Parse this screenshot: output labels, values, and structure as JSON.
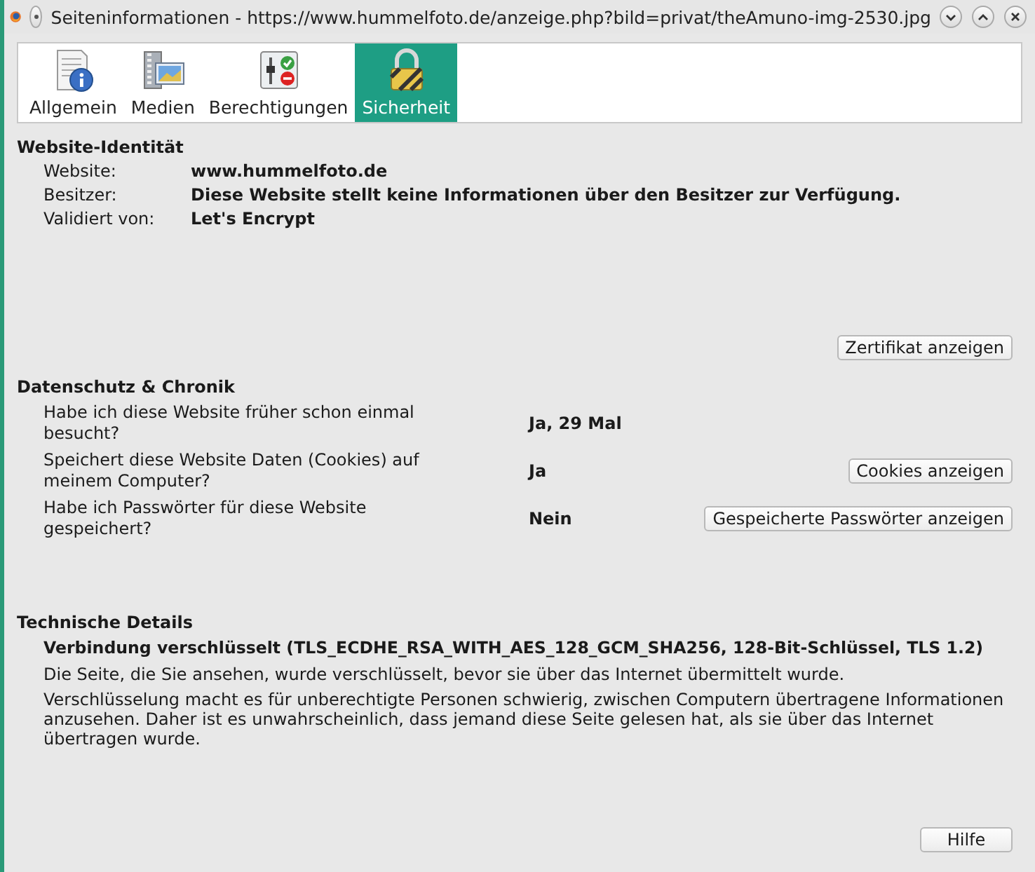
{
  "window": {
    "title": "Seiteninformationen - https://www.hummelfoto.de/anzeige.php?bild=privat/theAmuno-img-2530.jpg"
  },
  "tabs": [
    {
      "label": "Allgemein",
      "kind": "info",
      "selected": false
    },
    {
      "label": "Medien",
      "kind": "media",
      "selected": false
    },
    {
      "label": "Berechtigungen",
      "kind": "permissions",
      "selected": false
    },
    {
      "label": "Sicherheit",
      "kind": "lock",
      "selected": true
    }
  ],
  "identity": {
    "heading": "Website-Identität",
    "rows": [
      {
        "label": "Website:",
        "value": "www.hummelfoto.de"
      },
      {
        "label": "Besitzer:",
        "value": "Diese Website stellt keine Informationen über den Besitzer zur Verfügung."
      },
      {
        "label": "Validiert von:",
        "value": "Let's Encrypt"
      }
    ],
    "button": "Zertifikat anzeigen"
  },
  "privacy": {
    "heading": "Datenschutz & Chronik",
    "rows": [
      {
        "question": "Habe ich diese Website früher schon einmal besucht?",
        "answer": "Ja, 29 Mal"
      },
      {
        "question": "Speichert diese Website Daten (Cookies) auf meinem Computer?",
        "answer": "Ja",
        "button": "Cookies anzeigen"
      },
      {
        "question": "Habe ich Passwörter für diese Website gespeichert?",
        "answer": "Nein",
        "button": "Gespeicherte Passwörter anzeigen"
      }
    ]
  },
  "technical": {
    "heading": "Technische Details",
    "summary": "Verbindung verschlüsselt (TLS_ECDHE_RSA_WITH_AES_128_GCM_SHA256, 128-Bit-Schlüssel, TLS 1.2)",
    "paragraphs": [
      "Die Seite, die Sie ansehen, wurde verschlüsselt, bevor sie über das Internet übermittelt wurde.",
      "Verschlüsselung macht es für unberechtigte Personen schwierig, zwischen Computern übertragene Informationen anzusehen. Daher ist es unwahrscheinlich, dass jemand diese Seite gelesen hat, als sie über das Internet übertragen wurde."
    ]
  },
  "help_button": "Hilfe"
}
